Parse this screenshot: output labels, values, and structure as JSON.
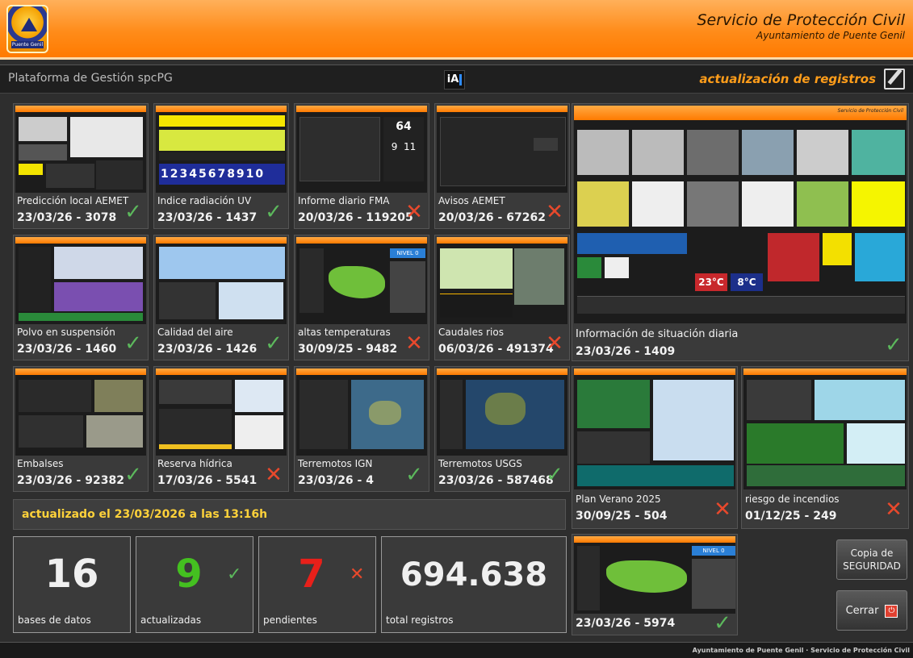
{
  "header": {
    "title": "Servicio de Protección Civil",
    "subtitle": "Ayuntamiento de Puente Genil",
    "logo_text": "Puente Genil"
  },
  "toolbar": {
    "platform": "Plataforma de Gestión spcPG",
    "ia_label": "iA",
    "update_link": "actualización de registros"
  },
  "tiles": [
    {
      "label": "Predicción local AEMET",
      "value": "23/03/26 - 3078",
      "status": "ok"
    },
    {
      "label": "Indice radiación UV",
      "value": "23/03/26 - 1437",
      "status": "ok"
    },
    {
      "label": "Informe diario FMA",
      "value": "20/03/26 - 119205",
      "status": "ko"
    },
    {
      "label": "Avisos AEMET",
      "value": "20/03/26 - 67262",
      "status": "ko"
    },
    {
      "label": "Polvo en suspensión",
      "value": "23/03/26 - 1460",
      "status": "ok"
    },
    {
      "label": "Calidad del aire",
      "value": "23/03/26 - 1426",
      "status": "ok"
    },
    {
      "label": "altas temperaturas",
      "value": "30/09/25 - 9482",
      "status": "ko"
    },
    {
      "label": "Caudales rios",
      "value": "06/03/26 - 491374",
      "status": "ko"
    },
    {
      "label": "Embalses",
      "value": "23/03/26 - 92382",
      "status": "ok"
    },
    {
      "label": "Reserva hídrica",
      "value": "17/03/26 - 5541",
      "status": "ko"
    },
    {
      "label": "Terremotos IGN",
      "value": "23/03/26 - 4",
      "status": "ok"
    },
    {
      "label": "Terremotos USGS",
      "value": "23/03/26 - 587468",
      "status": "ok"
    },
    {
      "label": "Información de situación diaria",
      "value": "23/03/26 - 1409",
      "status": "ok"
    },
    {
      "label": "Plan Verano 2025",
      "value": "30/09/25 - 504",
      "status": "ko"
    },
    {
      "label": "riesgo de incendios",
      "value": "01/12/25 - 249",
      "status": "ko"
    },
    {
      "label": "",
      "value": "23/03/26 - 5974",
      "status": "ok"
    }
  ],
  "thumb_texts": {
    "big_title": "Servicio de Protección Civil",
    "temp1": "23°C",
    "temp2": "8°C",
    "fma_num": "64",
    "fma_a": "9",
    "fma_b": "11",
    "uv_digits": "12345678910",
    "nivel": "NIVEL 0"
  },
  "banner": "actualizado el 23/03/2026 a las 13:16h",
  "stats": {
    "databases": {
      "value": "16",
      "label": "bases de datos"
    },
    "updated": {
      "value": "9",
      "label": "actualizadas"
    },
    "pending": {
      "value": "7",
      "label": "pendientes"
    },
    "total": {
      "value": "694.638",
      "label": "total registros"
    }
  },
  "buttons": {
    "backup": "Copia de SEGURIDAD",
    "close": "Cerrar"
  },
  "footer": "Ayuntamiento de Puente Genil · Servicio de Protección Civil",
  "icons": {
    "ok": "✓",
    "ko": "✕",
    "power": "⏻"
  },
  "colors": {
    "accent": "#ff8c1a",
    "ok": "#5cb85c",
    "ko": "#e8492c",
    "banner": "#ffd23a"
  }
}
